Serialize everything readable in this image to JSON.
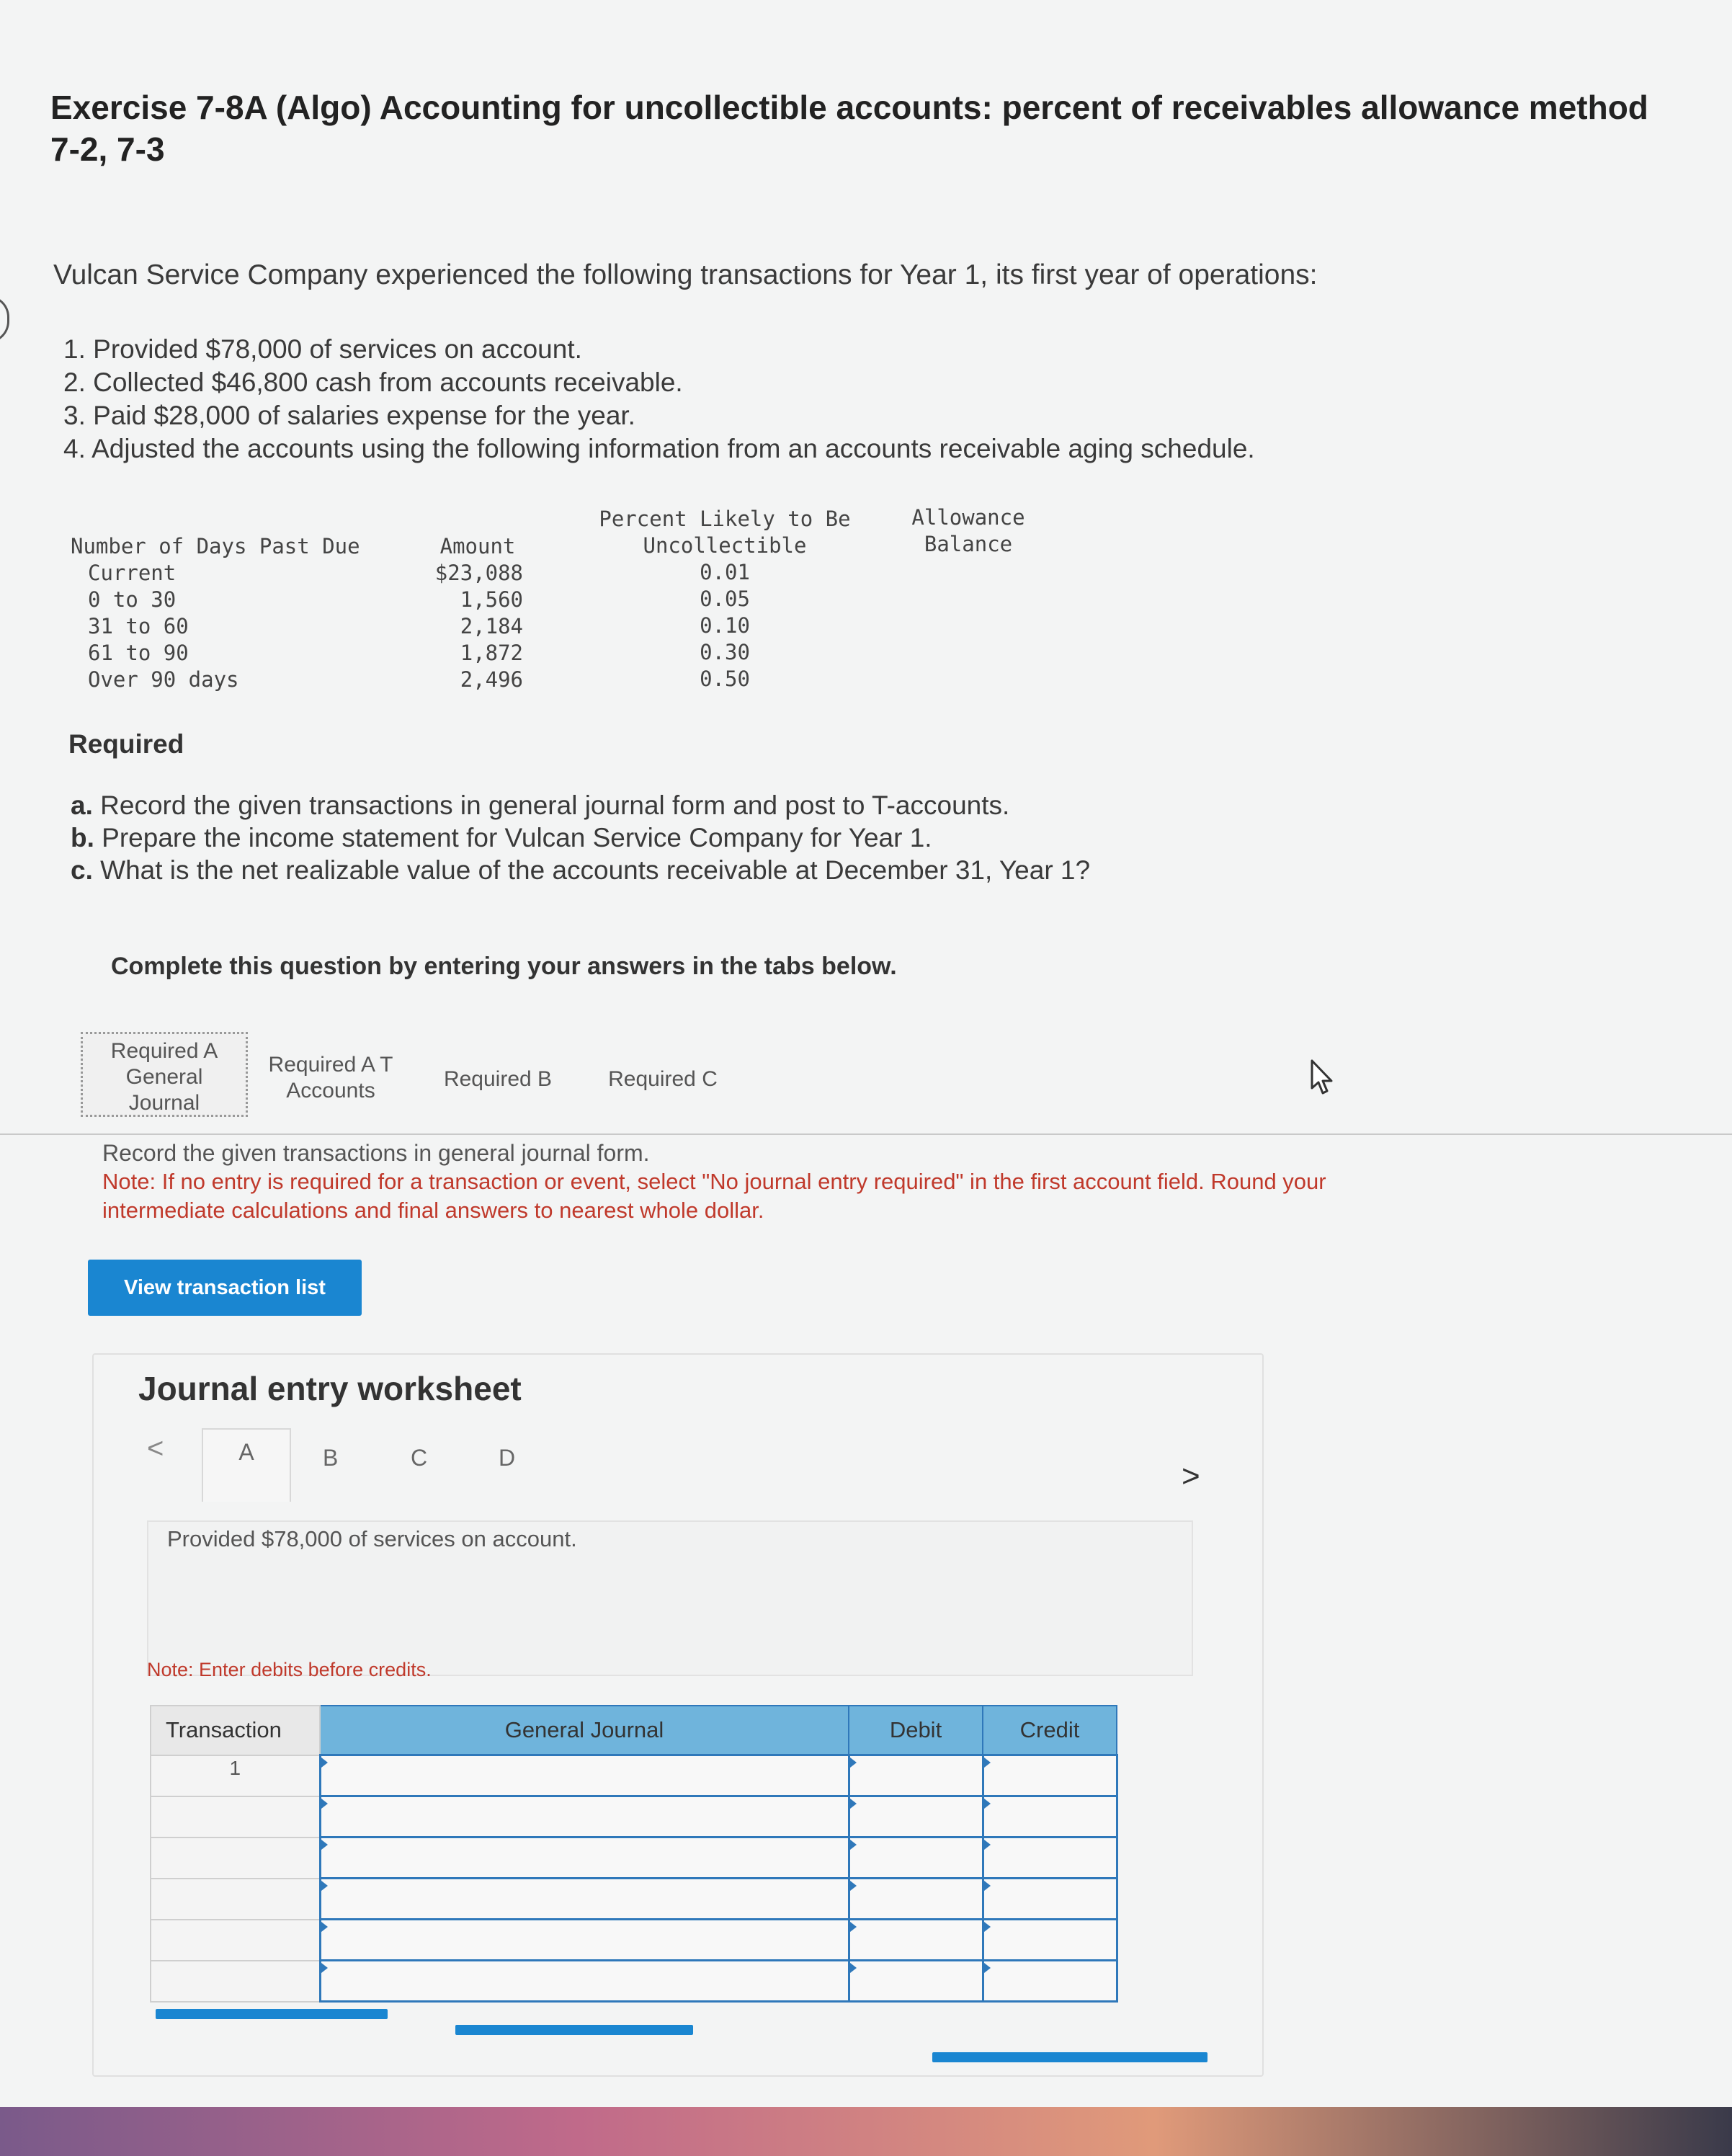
{
  "header": {
    "title_line1": "Exercise 7-8A (Algo) Accounting for uncollectible accounts: percent of receivables allowance method",
    "title_line2": "7-2, 7-3"
  },
  "problem": {
    "intro": "Vulcan Service Company experienced the following transactions for Year 1, its first year of operations:",
    "transactions": [
      "1. Provided $78,000 of services on account.",
      "2. Collected $46,800 cash from accounts receivable.",
      "3. Paid $28,000 of salaries expense for the year.",
      "4. Adjusted the accounts using the following information from an accounts receivable aging schedule."
    ]
  },
  "aging": {
    "headers": {
      "days": "Number of Days Past Due",
      "amount": "Amount",
      "percent_l1": "Percent Likely to Be",
      "percent_l2": "Uncollectible",
      "allowance_l1": "Allowance",
      "allowance_l2": "Balance"
    },
    "rows": [
      {
        "days": "Current",
        "amount": "$23,088",
        "percent": "0.01"
      },
      {
        "days": "0 to 30",
        "amount": "1,560",
        "percent": "0.05"
      },
      {
        "days": "31 to 60",
        "amount": "2,184",
        "percent": "0.10"
      },
      {
        "days": "61 to 90",
        "amount": "1,872",
        "percent": "0.30"
      },
      {
        "days": "Over 90 days",
        "amount": "2,496",
        "percent": "0.50"
      }
    ]
  },
  "required": {
    "heading": "Required",
    "items": [
      {
        "letter": "a.",
        "text": "Record the given transactions in general journal form and post to T-accounts."
      },
      {
        "letter": "b.",
        "text": "Prepare the income statement for Vulcan Service Company for Year 1."
      },
      {
        "letter": "c.",
        "text": "What is the net realizable value of the accounts receivable at December 31, Year 1?"
      }
    ]
  },
  "complete_text": "Complete this question by entering your answers in the tabs below.",
  "tabs": {
    "req_a_gj": [
      "Required A",
      "General",
      "Journal"
    ],
    "req_a_t": [
      "Required A T",
      "Accounts"
    ],
    "req_b": "Required B",
    "req_c": "Required C"
  },
  "instructions": {
    "line1": "Record the given transactions in general journal form.",
    "note_l1": "Note: If no entry is required for a transaction or event, select \"No journal entry required\" in the first account field. Round your",
    "note_l2": "intermediate calculations and final answers to nearest whole dollar."
  },
  "view_button": "View transaction list",
  "worksheet": {
    "title": "Journal entry worksheet",
    "prev": "<",
    "next": ">",
    "tabs": [
      "A",
      "B",
      "C",
      "D"
    ],
    "description": "Provided $78,000 of services on account.",
    "note": "Note: Enter debits before credits.",
    "table": {
      "headers": [
        "Transaction",
        "General Journal",
        "Debit",
        "Credit"
      ],
      "rows": [
        "1",
        "",
        "",
        "",
        "",
        ""
      ]
    }
  },
  "colors": {
    "button": "#1a86d1",
    "table_header": "#6fb4dc",
    "table_border": "#2f78ba",
    "note_red": "#c0392b"
  }
}
